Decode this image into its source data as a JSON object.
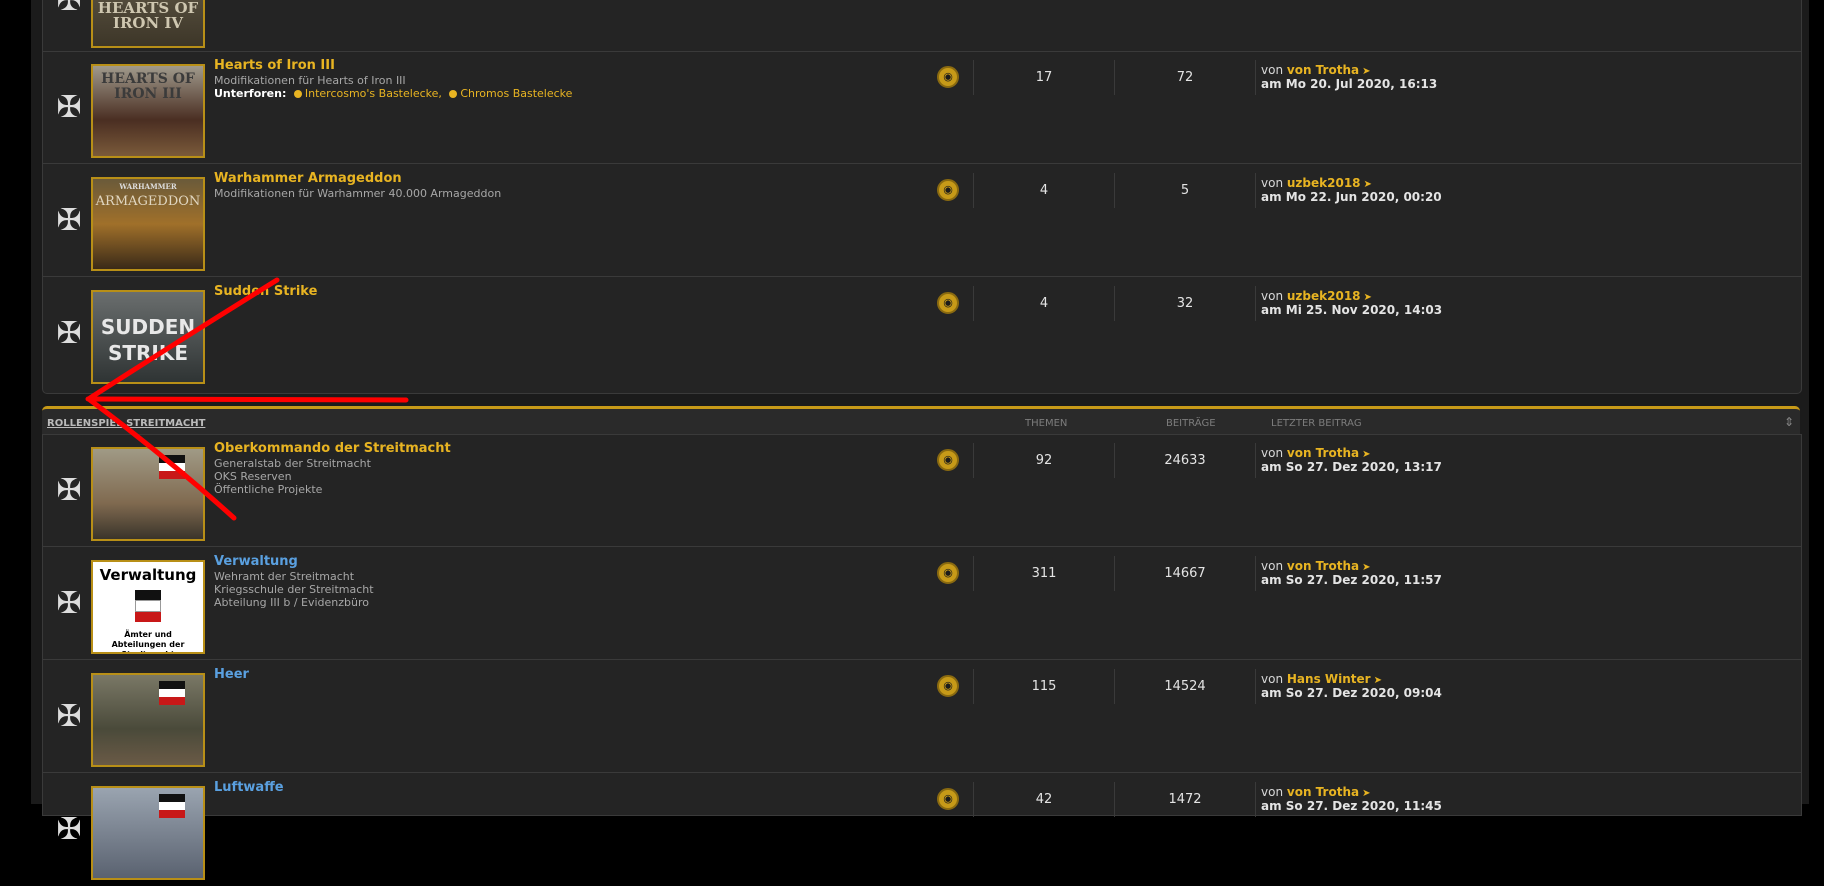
{
  "forums_top": [
    {
      "title": "",
      "description": "",
      "thumb_text": "HEARTS OF IRON IV",
      "topics": "",
      "posts": "",
      "last_by": "",
      "last_user": "",
      "last_date": ""
    },
    {
      "title": "Hearts of Iron III",
      "description": "Modifikationen für Hearts of Iron III",
      "subforums_label": "Unterforen:",
      "subforums": [
        "Intercosmo's Bastelecke,",
        "Chromos Bastelecke"
      ],
      "thumb_text": "HEARTS OF IRON III",
      "topics": "17",
      "posts": "72",
      "last_by": "von",
      "last_user": "von Trotha",
      "last_date": "am Mo 20. Jul 2020, 16:13"
    },
    {
      "title": "Warhammer Armageddon",
      "description": "Modifikationen für Warhammer 40.000 Armageddon",
      "thumb_text": "ARMAGEDDON",
      "thumb_small": "WARHAMMER",
      "topics": "4",
      "posts": "5",
      "last_by": "von",
      "last_user": "uzbek2018",
      "last_date": "am Mo 22. Jun 2020, 00:20"
    },
    {
      "title": "Sudden Strike",
      "description": "",
      "thumb_text": "SUDDEN STRIKE",
      "topics": "4",
      "posts": "32",
      "last_by": "von",
      "last_user": "uzbek2018",
      "last_date": "am Mi 25. Nov 2020, 14:03"
    }
  ],
  "category": {
    "title": "ROLLENSPIEL STREITMACHT",
    "col_topics": "THEMEN",
    "col_posts": "BEITRÄGE",
    "col_last": "LETZTER BEITRAG",
    "toggle": "⇕"
  },
  "forums_cat": [
    {
      "title": "Oberkommando der Streitmacht",
      "color": "gold",
      "lines": [
        "Generalstab der Streitmacht",
        "OKS Reserven",
        "Öffentliche Projekte"
      ],
      "topics": "92",
      "posts": "24633",
      "last_by": "von",
      "last_user": "von Trotha",
      "last_date": "am So 27. Dez 2020, 13:17"
    },
    {
      "title": "Verwaltung",
      "color": "blue",
      "lines": [
        "Wehramt der Streitmacht",
        "Kriegsschule der Streitmacht",
        "Abteilung III b / Evidenzbüro"
      ],
      "thumb_title": "Verwaltung",
      "thumb_caption": "Ämter und Abteilungen der Streitmacht",
      "topics": "311",
      "posts": "14667",
      "last_by": "von",
      "last_user": "von Trotha",
      "last_date": "am So 27. Dez 2020, 11:57"
    },
    {
      "title": "Heer",
      "color": "blue",
      "lines": [],
      "topics": "115",
      "posts": "14524",
      "last_by": "von",
      "last_user": "Hans Winter",
      "last_date": "am So 27. Dez 2020, 09:04"
    },
    {
      "title": "Luftwaffe",
      "color": "blue",
      "lines": [],
      "topics": "42",
      "posts": "1472",
      "last_by": "von",
      "last_user": "von Trotha",
      "last_date": "am So 27. Dez 2020, 11:45"
    }
  ],
  "icons": {
    "forum_status": "iron-cross-icon",
    "feed": "feed-icon",
    "goto_last": "goto-last-post-icon"
  },
  "colors": {
    "accent": "#e8b422",
    "link_blue": "#5aa0e0",
    "annotation": "#ff0000"
  }
}
